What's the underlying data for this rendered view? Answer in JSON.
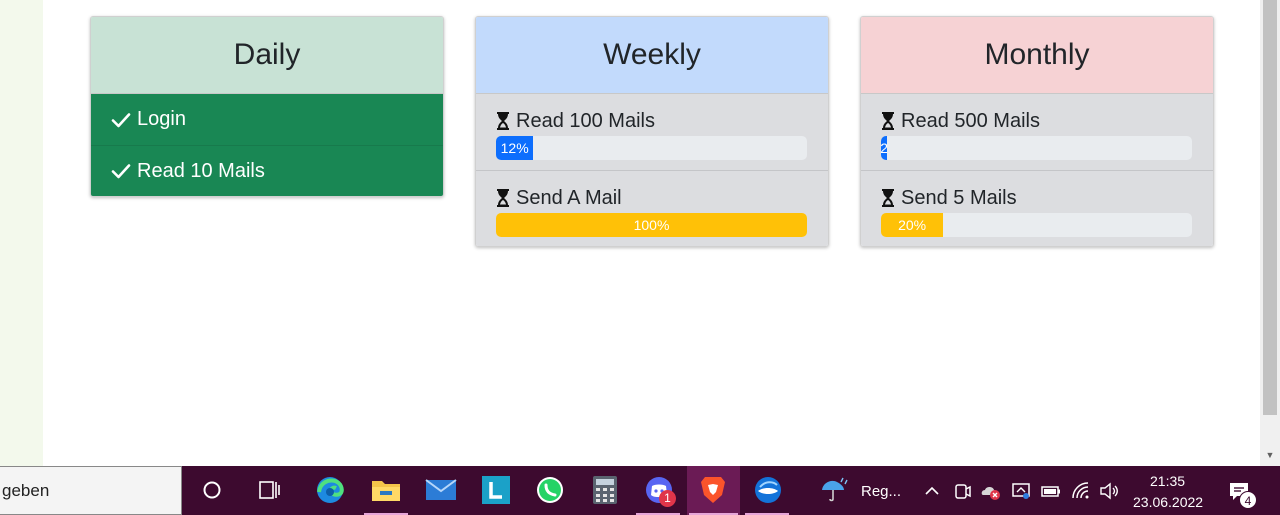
{
  "cards": {
    "daily": {
      "title": "Daily",
      "items": [
        {
          "label": "Login"
        },
        {
          "label": "Read 10 Mails"
        }
      ]
    },
    "weekly": {
      "title": "Weekly",
      "tasks": [
        {
          "label": "Read 100 Mails",
          "progress": 0.12,
          "progress_text": "12%",
          "color": "#0d6efd"
        },
        {
          "label": "Send A Mail",
          "progress": 1.0,
          "progress_text": "100%",
          "color": "#ffc107"
        }
      ]
    },
    "monthly": {
      "title": "Monthly",
      "tasks": [
        {
          "label": "Read 500 Mails",
          "progress": 0.02,
          "progress_text": "2",
          "color": "#0d6efd"
        },
        {
          "label": "Send 5 Mails",
          "progress": 0.2,
          "progress_text": "20%",
          "color": "#ffc107"
        }
      ]
    }
  },
  "taskbar": {
    "search_text": "geben",
    "weather_text": "Reg...",
    "time": "21:35",
    "date": "23.06.2022",
    "discord_badge": "1",
    "notification_badge": "4"
  },
  "colors": {
    "done_green": "#198754",
    "progress_blue": "#0d6efd",
    "progress_yellow": "#ffc107",
    "taskbar": "#3d0a2f"
  }
}
